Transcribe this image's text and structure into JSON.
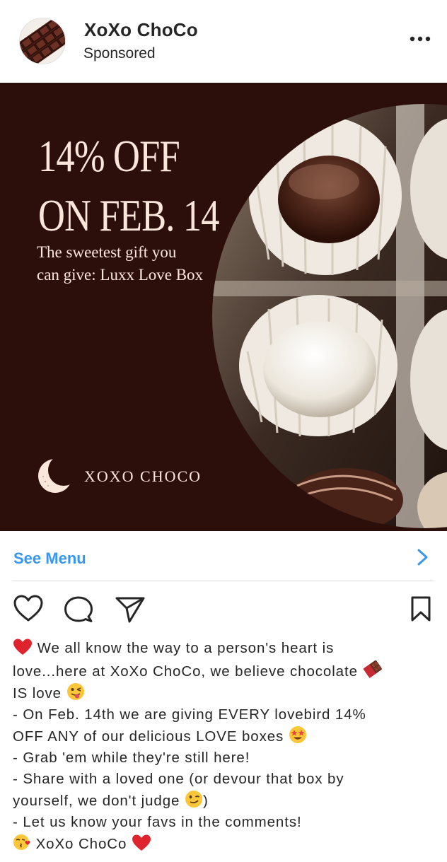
{
  "header": {
    "account_name": "XoXo ChoCo",
    "sponsored_label": "Sponsored",
    "more_icon": "more-horizontal-icon"
  },
  "ad": {
    "headline_line1": "14% OFF",
    "headline_line2": "ON FEB. 14",
    "tagline_line1": "The sweetest gift you",
    "tagline_line2": "can give: Luxx Love Box",
    "brand_text": "XOXO CHOCO",
    "colors": {
      "background": "#2c0f0b",
      "text": "#fbe6dc"
    }
  },
  "cta": {
    "label": "See Menu",
    "chevron_icon": "chevron-right-icon",
    "color": "#3897f0"
  },
  "actions": {
    "icons": [
      "heart-icon",
      "comment-icon",
      "share-icon",
      "bookmark-icon"
    ]
  },
  "caption": {
    "lines": [
      {
        "pre_emoji": "heart-emoji",
        "text": " We all know the way to a person's heart is"
      },
      {
        "text": "love...here at XoXo ChoCo, we believe chocolate ",
        "post_emoji": "chocolate-bar-emoji"
      },
      {
        "text": "IS love ",
        "post_emoji": "winking-tongue-emoji"
      },
      {
        "text": "- On Feb. 14th we are giving EVERY lovebird 14%"
      },
      {
        "text": "OFF ANY of our delicious LOVE boxes ",
        "post_emoji": "star-struck-emoji"
      },
      {
        "text": "- Grab 'em while they're still here!"
      },
      {
        "text": "- Share with a loved one (or devour that box by"
      },
      {
        "text": "yourself, we don't judge ",
        "post_emoji": "winking-face-emoji",
        "tail": ")"
      },
      {
        "text": "- Let us know your favs in the comments!"
      },
      {
        "pre_emoji": "kissing-face-emoji",
        "text": " XoXo ChoCo ",
        "post_emoji": "heart-emoji"
      }
    ]
  }
}
